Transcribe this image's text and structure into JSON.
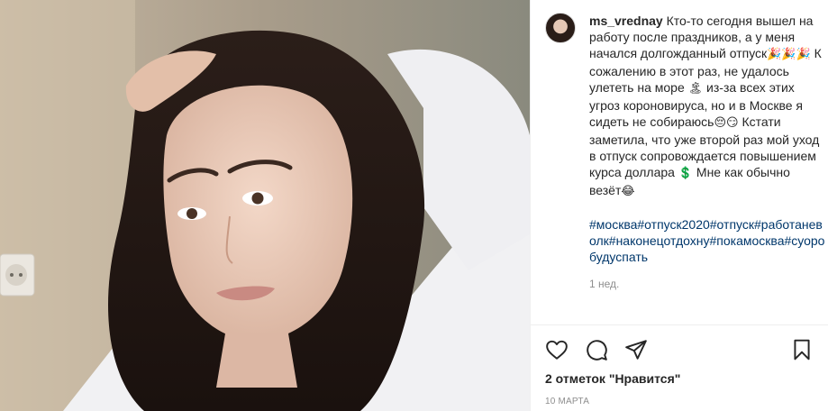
{
  "post": {
    "username": "ms_vrednay",
    "caption_parts": {
      "p1": " Кто-то сегодня вышел на работу после праздников, а у меня начался долгожданный отпуск",
      "e1": "🎉🎉🎉",
      "p2": " К сожалению в этот раз, не удалось улететь на море ",
      "e2": "🏝",
      "p3": " из-за всех этих угроз короновируса, но и в Москве я сидеть не собираюсь",
      "e3": "😔😏",
      "p4": " Кстати заметила, что уже второй раз мой уход в отпуск сопровождается повышением курса доллара ",
      "e4": "💲",
      "p5": " Мне как обычно везёт",
      "e5": "😂"
    },
    "hashtags": [
      "#москва",
      "#отпуск2020",
      "#отпуск",
      "#работаневолк",
      "#наконецотдохну",
      "#покамосква",
      "#суоробудуспать"
    ],
    "time_ago": "1 нед.",
    "likes": "2 отметок \"Нравится\"",
    "date": "10 марта"
  },
  "icons": {
    "like": "heart-icon",
    "comment": "comment-icon",
    "share": "share-icon",
    "save": "bookmark-icon"
  },
  "colors": {
    "text": "#262626",
    "hashtag": "#00376b",
    "muted": "#8e8e8e",
    "border": "#efefef"
  }
}
